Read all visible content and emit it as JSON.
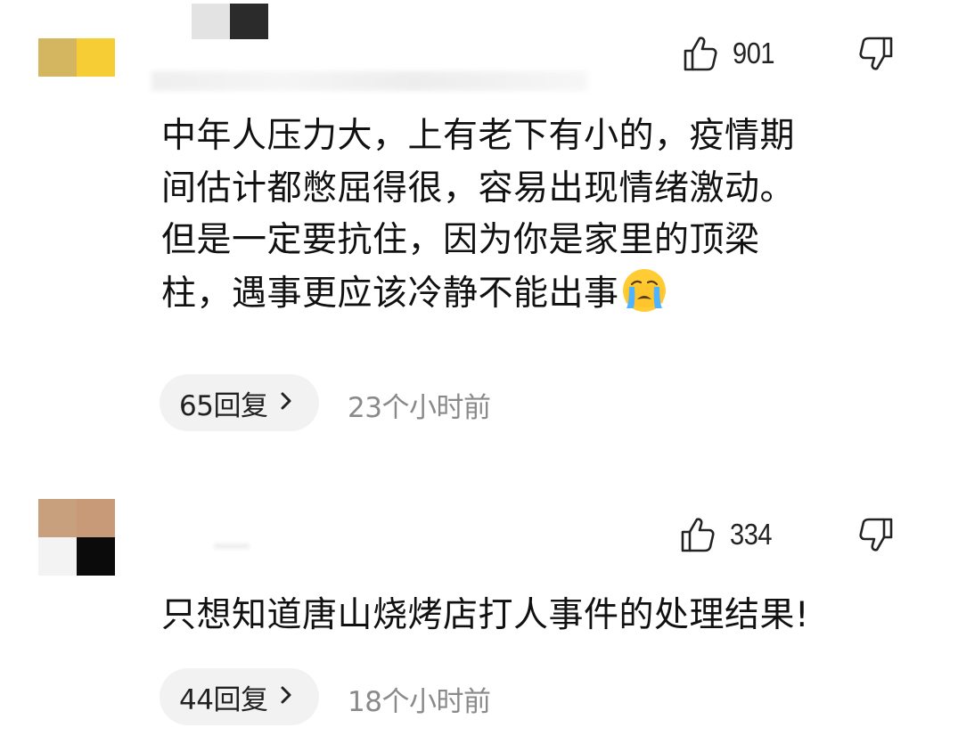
{
  "comments": [
    {
      "avatar_colors": [
        "#d4b560",
        "#f7cd35"
      ],
      "like_count": "901",
      "text_lines": [
        "中年人压力大，上有老下有小的，疫情期",
        "间估计都憋屈得很，容易出现情绪激动。",
        "但是一定要抗住，因为你是家里的顶梁",
        "柱，遇事更应该冷静不能出事"
      ],
      "emoji": "crying-face",
      "reply_label": "65回复",
      "timestamp": "23个小时前"
    },
    {
      "avatar_colors": [
        "#c8a07e",
        "#c99a78",
        "#f3f3f3",
        "#0b0b0b"
      ],
      "like_count": "334",
      "text_lines": [
        "只想知道唐山烧烤店打人事件的处理结果!"
      ],
      "reply_label": "44回复",
      "timestamp": "18个小时前"
    }
  ],
  "icons": {
    "like": "thumbs-up-outline-icon",
    "dislike": "thumbs-down-outline-icon",
    "chevron": "chevron-right-icon",
    "emoji": "crying-face-emoji-icon"
  },
  "colors": {
    "text": "#111111",
    "secondary_text": "#8a8a8a",
    "pill_bg": "#f2f2f2",
    "background": "#ffffff"
  }
}
